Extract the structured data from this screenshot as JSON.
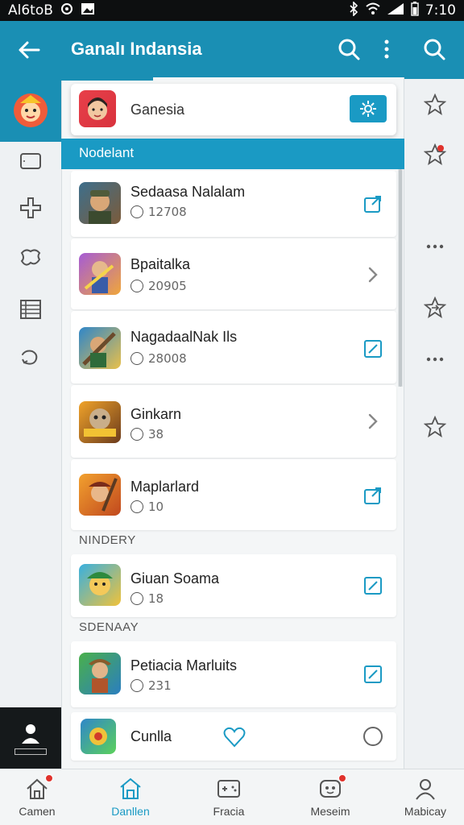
{
  "status_bar": {
    "left_text": "Al6toВ",
    "time": "7:10"
  },
  "app_bar": {
    "title": "Ganalı Indansia"
  },
  "search_card": {
    "label": "Ganesia"
  },
  "section_band": {
    "label": "Nodelant"
  },
  "list_items": [
    {
      "title": "Sedaasa Nalalam",
      "meta": "12708",
      "trailing": "edit-share-icon"
    },
    {
      "title": "Bpaitalka",
      "meta": "20905",
      "trailing": "chevron-right-icon"
    },
    {
      "title": "NagadaalNak Ils",
      "meta": "28008",
      "trailing": "edit-icon"
    },
    {
      "title": "Ginkarn",
      "meta": "38",
      "trailing": "chevron-right-icon"
    },
    {
      "title": "Maplarlard",
      "meta": "10",
      "trailing": "edit-share-icon"
    }
  ],
  "section_2": {
    "label": "NINDERY"
  },
  "list_items_2": [
    {
      "title": "Giuan Soama",
      "meta": "18",
      "trailing": "edit-icon"
    }
  ],
  "section_3": {
    "label": "SDENAAY"
  },
  "list_items_3": [
    {
      "title": "Petiacia Marluits",
      "meta": "231",
      "trailing": "edit-icon"
    },
    {
      "title": "Cunlla",
      "meta": "",
      "trailing": "radio-icon"
    }
  ],
  "bottom_nav": [
    {
      "label": "Camen",
      "icon": "home-icon",
      "badge": true
    },
    {
      "label": "Danllen",
      "icon": "store-icon",
      "badge": false,
      "active": true
    },
    {
      "label": "Fracia",
      "icon": "controller-icon",
      "badge": false
    },
    {
      "label": "Meseim",
      "icon": "mascot-icon",
      "badge": true
    },
    {
      "label": "Mabicay",
      "icon": "person-icon",
      "badge": false
    }
  ],
  "colors": {
    "accent": "#1a9ac4",
    "app_bar": "#1a8fb4",
    "badge": "#e0322c"
  }
}
